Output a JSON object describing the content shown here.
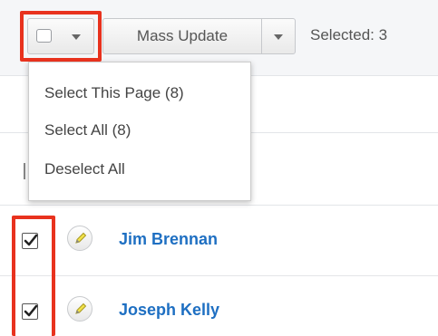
{
  "toolbar": {
    "mass_update_label": "Mass Update",
    "selected_label": "Selected: 3"
  },
  "dropdown": {
    "items": [
      {
        "label": "Select This Page (8)"
      },
      {
        "label": "Select All (8)"
      },
      {
        "label": "Deselect All"
      }
    ]
  },
  "records": [
    {
      "name": "Jim Brennan",
      "checked": true
    },
    {
      "name": "Joseph Kelly",
      "checked": true
    }
  ],
  "colors": {
    "highlight": "#e8321e",
    "link": "#1e6fc2"
  },
  "icons": [
    "checkbox-icon",
    "chevron-down-icon",
    "pencil-icon",
    "checkmark-icon"
  ]
}
